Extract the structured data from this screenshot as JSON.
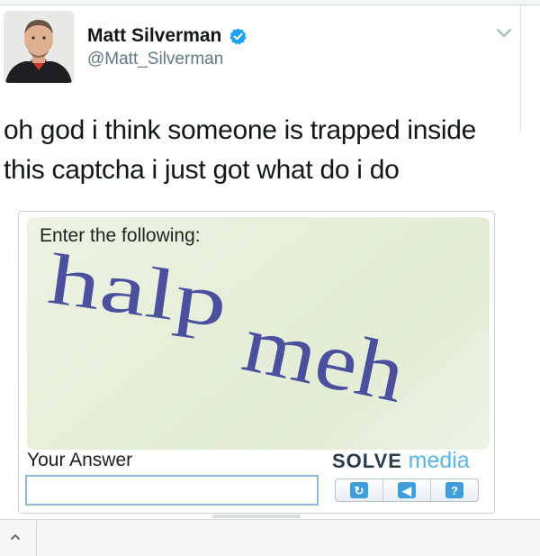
{
  "tweet": {
    "author_name": "Matt Silverman",
    "handle": "@Matt_Silverman",
    "text_line1": "oh god i think someone is trapped inside",
    "text_line2": "this captcha i just got what do i do"
  },
  "captcha": {
    "prompt": "Enter the following:",
    "word1": "halp",
    "word2": "meh",
    "answer_label": "Your Answer",
    "answer_value": "",
    "brand_solve": "SOLVE",
    "brand_media": "media",
    "controls": [
      {
        "icon": "refresh-icon",
        "glyph": "↻"
      },
      {
        "icon": "audio-icon",
        "glyph": "◀"
      },
      {
        "icon": "help-icon",
        "glyph": "?"
      }
    ]
  },
  "colors": {
    "verified": "#1da1f2",
    "captcha_text": "#4a4f9e",
    "brand_media": "#5ab4e6",
    "handle": "#657786"
  },
  "icons": {
    "verified": "verified-badge-icon",
    "tweet_menu": "chevron-down-icon",
    "scroll_up": "chevron-up-icon"
  }
}
